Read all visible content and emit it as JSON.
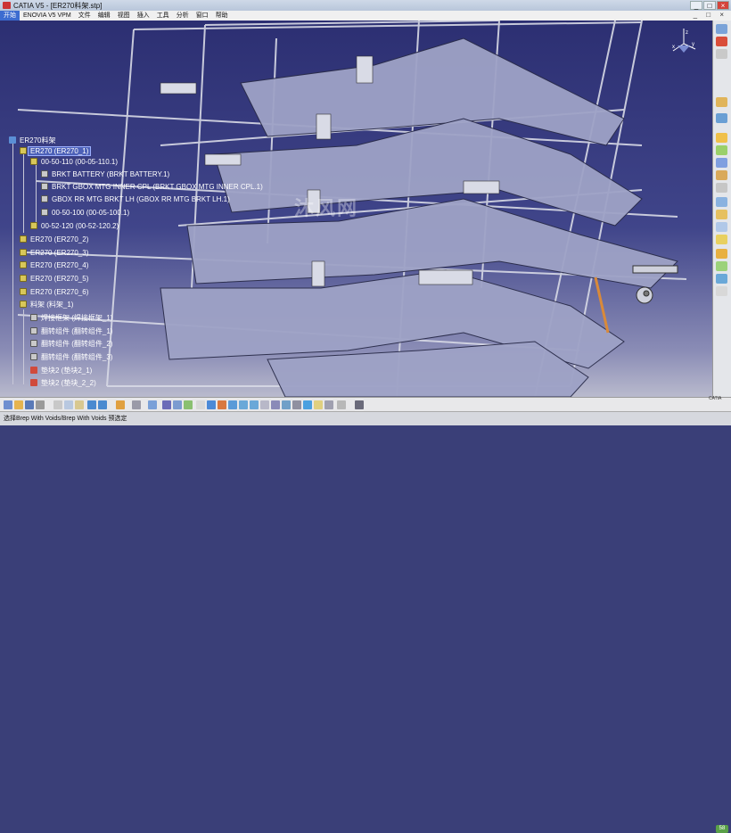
{
  "window": {
    "title": "CATIA V5 - [ER270料架.stp]",
    "minimize": "_",
    "maximize": "□",
    "close": "×"
  },
  "menu": [
    "开始",
    "ENOVIA V5 VPM",
    "文件",
    "编辑",
    "视图",
    "插入",
    "工具",
    "分析",
    "窗口",
    "帮助"
  ],
  "menu_controls": "_ □ ×",
  "tree": {
    "root": "ER270料架",
    "items": [
      {
        "label": "ER270 (ER270_1)",
        "selected": true
      },
      {
        "label": "00-50-110 (00-05-110.1)"
      },
      {
        "label": "BRKT BATTERY (BRKT BATTERY.1)"
      },
      {
        "label": "BRKT GBOX MTG INNER CPL (BRKT GBOX MTG INNER CPL.1)"
      },
      {
        "label": "GBOX RR MTG BRKT LH (GBOX RR MTG BRKT LH.1)"
      },
      {
        "label": "00-50-100 (00-05-100.1)"
      },
      {
        "label": "00-52-120 (00-52-120.2)"
      },
      {
        "label": "ER270 (ER270_2)"
      },
      {
        "label": "ER270 (ER270_3)"
      },
      {
        "label": "ER270 (ER270_4)"
      },
      {
        "label": "ER270 (ER270_5)"
      },
      {
        "label": "ER270 (ER270_6)"
      },
      {
        "label": "料架 (料架_1)"
      },
      {
        "label": "焊接框架 (焊接框架_1)"
      },
      {
        "label": "翻转组件 (翻转组件_1)"
      },
      {
        "label": "翻转组件 (翻转组件_2)"
      },
      {
        "label": "翻转组件 (翻转组件_3)"
      },
      {
        "label": "垫块2 (垫块2_1)"
      },
      {
        "label": "垫块2 (垫块_2_2)"
      }
    ]
  },
  "watermark": "沐风网",
  "compass_labels": {
    "x": "x",
    "y": "y",
    "z": "z"
  },
  "status_text": "选择Brep With Voids/Brep With Voids 预选定",
  "catia_logo": "CATIA",
  "badge": "58"
}
